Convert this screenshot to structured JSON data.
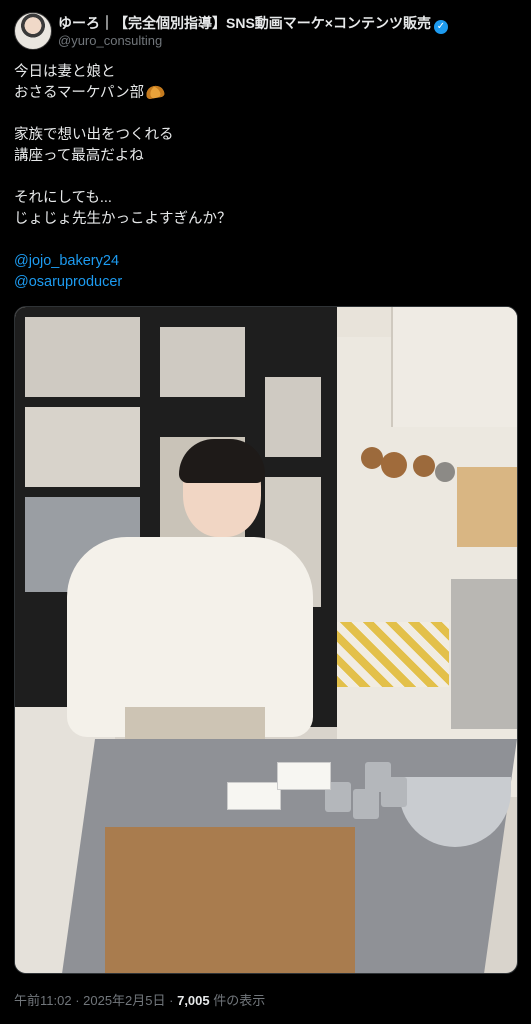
{
  "author": {
    "display_name": "ゆーろ｜【完全個別指導】SNS動画マーケ×コンテンツ販売",
    "handle": "@yuro_consulting"
  },
  "tweet": {
    "line1": "今日は妻と娘と",
    "line2": "おさるマーケパン部",
    "line3": "家族で想い出をつくれる",
    "line4": "講座って最高だよね",
    "line5": "それにしても...",
    "line6": "じょじょ先生かっこよすぎんか？",
    "mention1": "@jojo_bakery24",
    "mention2": "@osaruproducer"
  },
  "footer": {
    "time": "午前11:02",
    "sep1": " · ",
    "date": "2025年2月5日",
    "sep2": " · ",
    "views": "7,005",
    "views_label": " 件の表示"
  }
}
